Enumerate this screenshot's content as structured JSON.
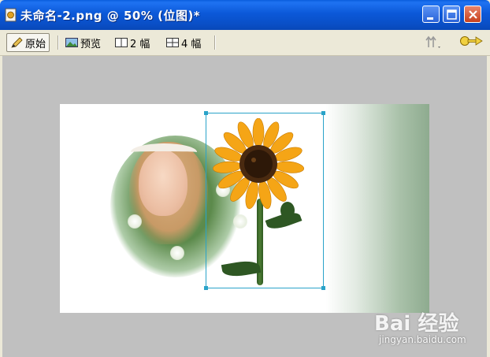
{
  "window": {
    "title": "未命名-2.png @  50% (位图)*"
  },
  "toolbar": {
    "original_label": "原始",
    "preview_label": "预览",
    "two_up_label": "2 幅",
    "four_up_label": "4 幅"
  },
  "icons": {
    "app": "fireworks-document-icon",
    "original": "pencil-icon",
    "preview": "landscape-image-icon",
    "two_up": "split-two-icon",
    "four_up": "split-four-icon",
    "export": "export-arrow-icon",
    "key": "key-arrow-icon"
  },
  "watermark": {
    "brand": "Bai 经验",
    "url": "jingyan.baidu.com"
  },
  "colors": {
    "titlebar": "#0a58d8",
    "selection": "#2aa3c9",
    "workspace": "#c0c0c0"
  }
}
